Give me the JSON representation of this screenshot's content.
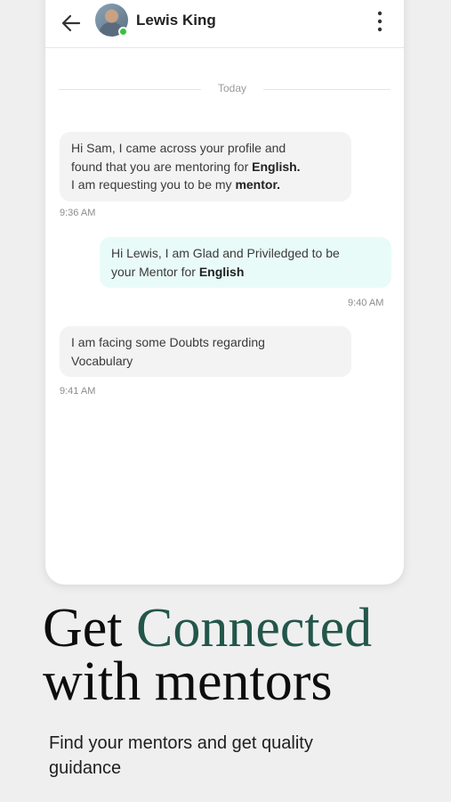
{
  "chat": {
    "contact_name": "Lewis King",
    "contact_status_color": "#34c43a",
    "header_icons": [
      "back-arrow-icon",
      "more-vertical-icon"
    ],
    "date_separator": "Today",
    "messages": [
      {
        "direction": "incoming",
        "parts": [
          "Hi Sam, I came across your profile and",
          "found that you are mentoring for ",
          "English.",
          "I am requesting you to be my ",
          "mentor."
        ],
        "time": "9:36 AM"
      },
      {
        "direction": "outgoing",
        "parts": [
          "Hi Lewis, I am Glad and Priviledged to be",
          "your Mentor for ",
          "English"
        ],
        "time": "9:40 AM"
      },
      {
        "direction": "incoming",
        "parts": [
          "I am facing some Doubts regarding",
          "Vocabulary"
        ],
        "time": "9:41 AM"
      }
    ]
  },
  "promo": {
    "headline_word1": "Get",
    "headline_accent": "Connected",
    "headline_line2": "with mentors",
    "subtitle": "Find your mentors and get quality guidance",
    "accent_color": "#23564a"
  }
}
